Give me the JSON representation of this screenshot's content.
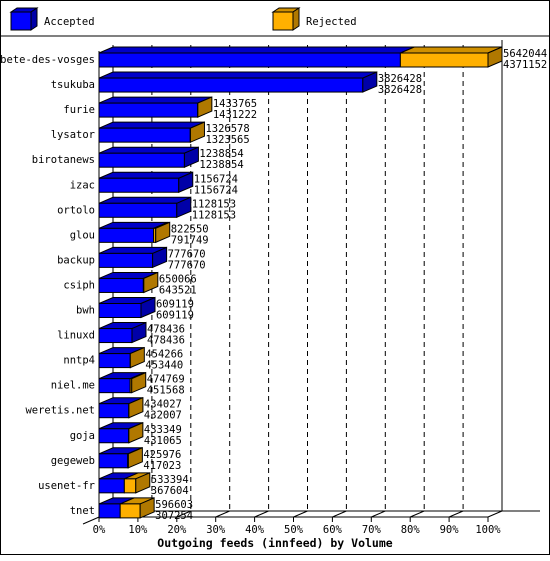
{
  "chart_data": {
    "type": "bar",
    "orientation": "horizontal",
    "style": "3d-stacked-overlay",
    "title": "",
    "xlabel": "Outgoing feeds (innfeed) by Volume",
    "ylabel": "",
    "xlim": [
      0,
      100
    ],
    "x_unit": "% of maximum total",
    "grid": true,
    "legend_position": "top",
    "x_ticks": [
      "0%",
      "10%",
      "20%",
      "30%",
      "40%",
      "50%",
      "60%",
      "70%",
      "80%",
      "90%",
      "100%"
    ],
    "categories": [
      "bete-des-vosges",
      "tsukuba",
      "furie",
      "lysator",
      "birotanews",
      "izac",
      "ortolo",
      "glou",
      "backup",
      "csiph",
      "bwh",
      "linuxd",
      "nntp4",
      "niel.me",
      "weretis.net",
      "goja",
      "gegeweb",
      "usenet-fr",
      "tnet"
    ],
    "series": [
      {
        "name": "Accepted",
        "color": "#0000ff",
        "values": [
          4371152,
          3826428,
          1431222,
          1323565,
          1238854,
          1156724,
          1128153,
          791749,
          777670,
          643521,
          609119,
          478436,
          453440,
          451568,
          432007,
          431065,
          417023,
          367604,
          307254
        ]
      },
      {
        "name": "Total (incl. Rejected)",
        "legend_name": "Rejected",
        "color": "#ffb000",
        "values": [
          5642044,
          3826428,
          1433765,
          1326578,
          1238854,
          1156724,
          1128153,
          822550,
          777670,
          650066,
          609119,
          478436,
          454266,
          474769,
          434027,
          433349,
          425976,
          533394,
          596603
        ]
      }
    ],
    "max_value": 5642044
  },
  "legend": {
    "accepted_label": "Accepted",
    "rejected_label": "Rejected",
    "accepted_color": "#0000ff",
    "rejected_color": "#ffb000"
  }
}
